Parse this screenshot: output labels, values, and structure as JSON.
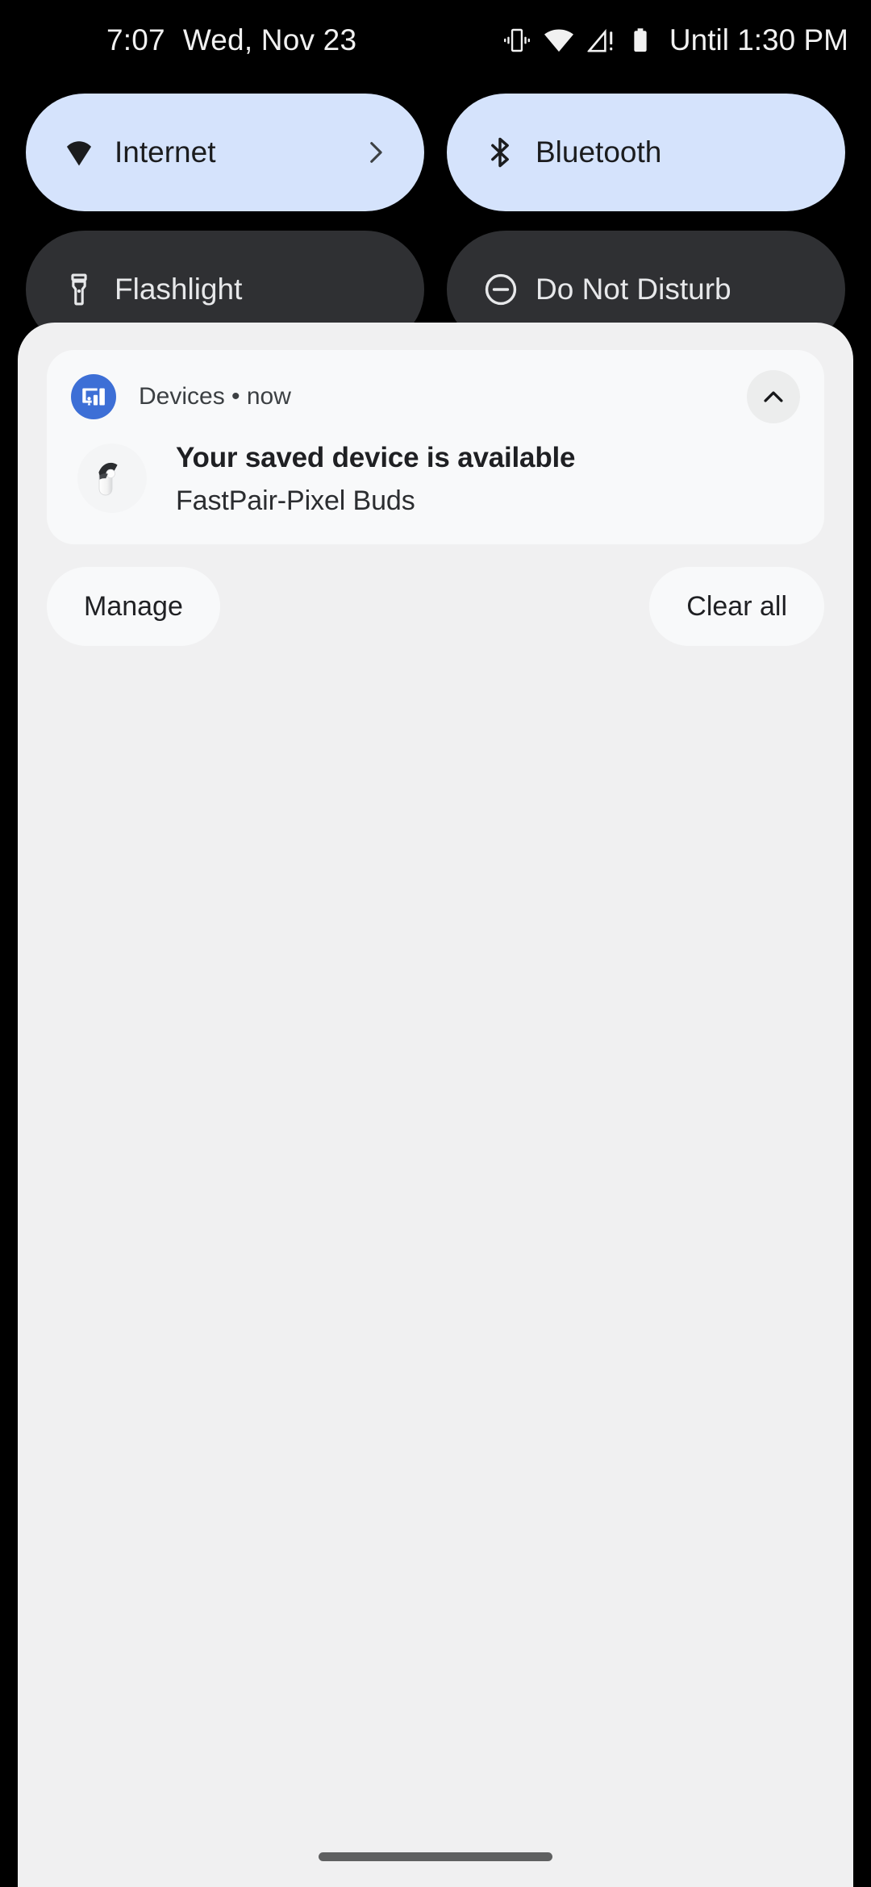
{
  "status_bar": {
    "clock": "7:07",
    "date": "Wed, Nov 23",
    "battery_text": "Until 1:30 PM",
    "icons": [
      "vibrate-icon",
      "wifi-icon",
      "cellular-no-signal-icon",
      "battery-icon"
    ]
  },
  "quick_settings": {
    "tiles": [
      {
        "label": "Internet",
        "icon": "wifi-icon",
        "state": "on",
        "has_chevron": true
      },
      {
        "label": "Bluetooth",
        "icon": "bluetooth-icon",
        "state": "on",
        "has_chevron": false
      },
      {
        "label": "Flashlight",
        "icon": "flashlight-icon",
        "state": "off",
        "has_chevron": false
      },
      {
        "label": "Do Not Disturb",
        "icon": "do-not-disturb-icon",
        "state": "off",
        "has_chevron": false
      }
    ],
    "colors": {
      "tile_on_bg": "#d5e3fc",
      "tile_on_fg": "#1b1c1e",
      "tile_off_bg": "#2f3033",
      "tile_off_fg": "#e7e8ea"
    }
  },
  "notification": {
    "app_name": "Devices",
    "separator": "•",
    "time": "now",
    "header_line": "Devices • now",
    "title": "Your saved device is available",
    "subtitle": "FastPair-Pixel Buds",
    "app_icon": "devices-cast-icon",
    "device_image": "pixel-buds-case-image",
    "expand_icon": "chevron-up-icon",
    "badge_color": "#3d6fd6"
  },
  "shade_actions": {
    "manage_label": "Manage",
    "clear_all_label": "Clear all"
  },
  "system": {
    "shade_bg": "#f0f0f1",
    "card_bg": "#f8f9fa",
    "home_indicator": "home-indicator"
  }
}
